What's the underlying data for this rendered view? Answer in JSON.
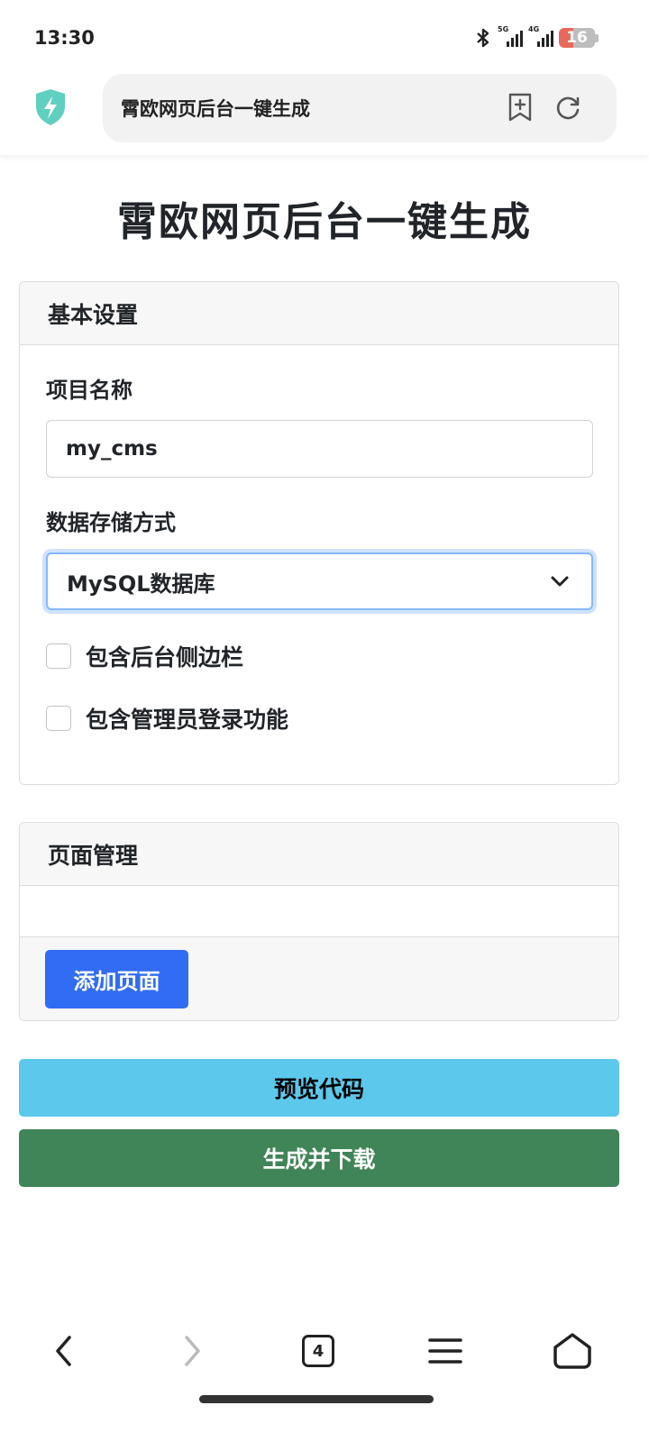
{
  "status_bar": {
    "time": "13:30",
    "network_1": "5G",
    "network_2": "4G",
    "battery": "16"
  },
  "browser": {
    "url_title": "霄欧网页后台一键生成",
    "tab_count": "4"
  },
  "page": {
    "title": "霄欧网页后台一键生成",
    "basic_settings": {
      "header": "基本设置",
      "project_name_label": "项目名称",
      "project_name_value": "my_cms",
      "storage_label": "数据存储方式",
      "storage_value": "MySQL数据库",
      "include_sidebar_label": "包含后台侧边栏",
      "include_admin_login_label": "包含管理员登录功能"
    },
    "page_management": {
      "header": "页面管理",
      "add_page_button": "添加页面"
    },
    "preview_button": "预览代码",
    "generate_button": "生成并下载"
  },
  "colors": {
    "primary": "#316cf4",
    "info": "#5bc8ec",
    "success": "#3f8557",
    "focus_ring": "#86b7fe",
    "shield": "#5fcfc0",
    "battery_low": "#e8685b"
  },
  "icons": {
    "bluetooth": "bluetooth-icon",
    "shield": "shield-bolt-icon",
    "bookmark": "bookmark-add-icon",
    "reload": "reload-icon",
    "back": "back-arrow-icon",
    "forward": "forward-arrow-icon",
    "tabs": "tabs-icon",
    "menu": "menu-icon",
    "home": "home-icon"
  }
}
